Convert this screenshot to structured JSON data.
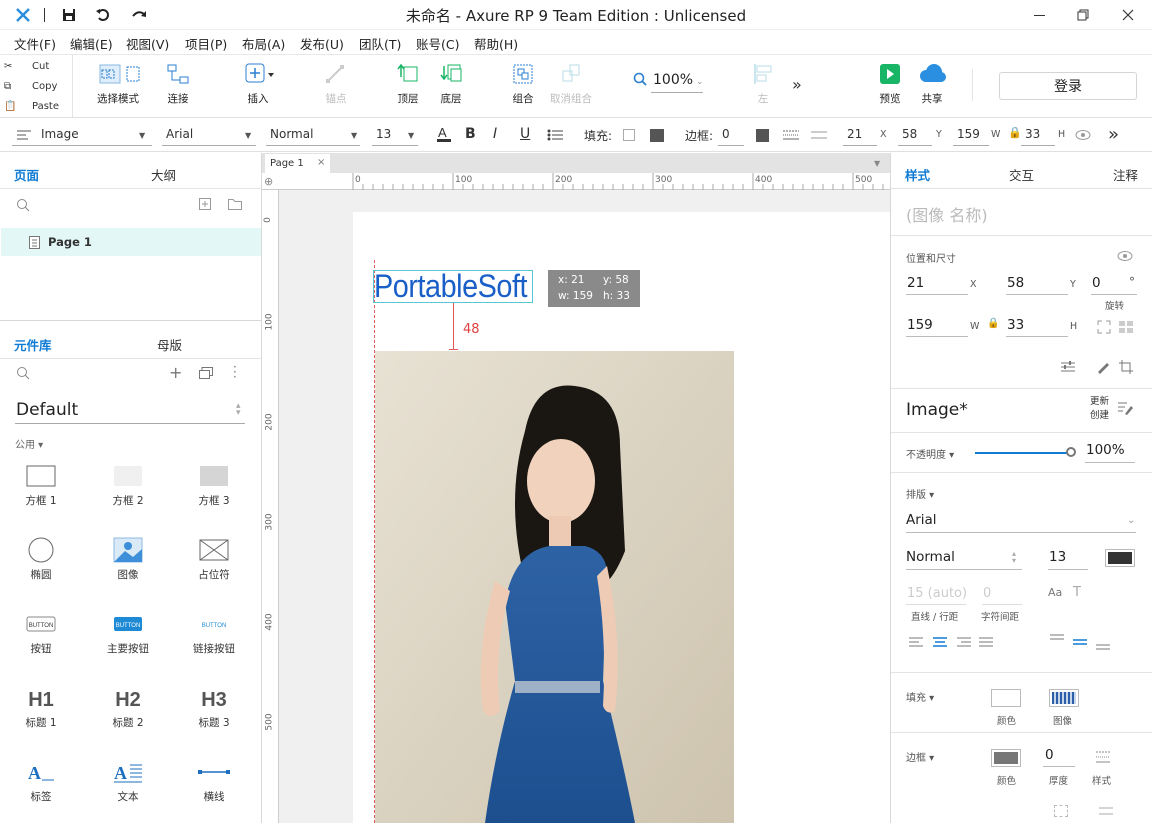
{
  "window": {
    "title": "未命名 - Axure RP 9 Team Edition : Unlicensed",
    "controls": [
      "minimize",
      "maximize",
      "close"
    ]
  },
  "menu": [
    "文件(F)",
    "编辑(E)",
    "视图(V)",
    "项目(P)",
    "布局(A)",
    "发布(U)",
    "团队(T)",
    "账号(C)",
    "帮助(H)"
  ],
  "clipboard": {
    "cut": "Cut",
    "copy": "Copy",
    "paste": "Paste"
  },
  "toolbar": {
    "select_mode": "选择模式",
    "connect": "连接",
    "insert": "插入",
    "points": "锚点",
    "top": "顶层",
    "bottom": "底层",
    "group": "组合",
    "ungroup": "取消组合",
    "zoom": "100%",
    "left": "左",
    "preview": "预览",
    "share": "共享",
    "login": "登录"
  },
  "format": {
    "element_type": "Image",
    "font": "Arial",
    "weight": "Normal",
    "size": "13",
    "fill_label": "填充:",
    "border_label": "边框:",
    "border_value": "0",
    "x": "21",
    "x_label": "X",
    "y": "58",
    "y_label": "Y",
    "w": "159",
    "w_label": "W",
    "h": "33",
    "h_label": "H"
  },
  "left": {
    "tab_pages": "页面",
    "tab_outline": "大纲",
    "page_item": "Page 1",
    "tab_library": "元件库",
    "tab_masters": "母版",
    "library_name": "Default",
    "group_label": "公用",
    "widgets": [
      {
        "label": "方框 1",
        "icon": "box1-icon"
      },
      {
        "label": "方框 2",
        "icon": "box2-icon"
      },
      {
        "label": "方框 3",
        "icon": "box3-icon"
      },
      {
        "label": "椭圆",
        "icon": "ellipse-icon"
      },
      {
        "label": "图像",
        "icon": "image-icon"
      },
      {
        "label": "占位符",
        "icon": "placeholder-icon"
      },
      {
        "label": "按钮",
        "icon": "button-icon",
        "text": "BUTTON"
      },
      {
        "label": "主要按钮",
        "icon": "primary-button-icon",
        "text": "BUTTON"
      },
      {
        "label": "链接按钮",
        "icon": "link-button-icon",
        "text": "BUTTON"
      },
      {
        "label": "标题 1",
        "icon": "h1-icon",
        "text": "H1"
      },
      {
        "label": "标题 2",
        "icon": "h2-icon",
        "text": "H2"
      },
      {
        "label": "标题 3",
        "icon": "h3-icon",
        "text": "H3"
      },
      {
        "label": "标签",
        "icon": "label-icon",
        "text": "A"
      },
      {
        "label": "文本",
        "icon": "text-icon",
        "text": "A"
      },
      {
        "label": "横线",
        "icon": "hline-icon"
      }
    ]
  },
  "canvas": {
    "tab": "Page 1",
    "ruler_h": [
      "0",
      "100",
      "200",
      "300",
      "400",
      "500"
    ],
    "ruler_v": [
      "0",
      "100",
      "200",
      "300",
      "400",
      "500"
    ],
    "logo_text": "PortableSoft",
    "tooltip": {
      "x": "x: 21",
      "y": "y: 58",
      "w": "w: 159",
      "h": "h: 33"
    },
    "spacing": "48"
  },
  "right": {
    "tab_style": "样式",
    "tab_interact": "交互",
    "tab_notes": "注释",
    "name_placeholder": "(图像 名称)",
    "pos_label": "位置和尺寸",
    "x": "21",
    "x_label": "X",
    "y": "58",
    "y_label": "Y",
    "rot": "0",
    "rot_unit": "°",
    "rot_label": "旋转",
    "w": "159",
    "w_label": "W",
    "h": "33",
    "h_label": "H",
    "style_name": "Image*",
    "update": "更新",
    "create": "创建",
    "opacity_label": "不透明度",
    "opacity": "100%",
    "opacity_value": 1.0,
    "typo_label": "排版",
    "font": "Arial",
    "weight": "Normal",
    "size": "13",
    "line_spacing": "15 (auto)",
    "char_spacing": "0",
    "line_label": "直线 / 行距",
    "char_label": "字符间距",
    "fill_label": "填充",
    "fill_color": "颜色",
    "fill_image": "图像",
    "border_label": "边框",
    "border_color": "颜色",
    "border_thickness": "0",
    "thickness_label": "厚度",
    "border_style": "样式"
  },
  "colors": {
    "accent": "#0f7bd3",
    "logo": "#1a5fc7",
    "green": "#19b566",
    "spacing_red": "#e04040"
  }
}
